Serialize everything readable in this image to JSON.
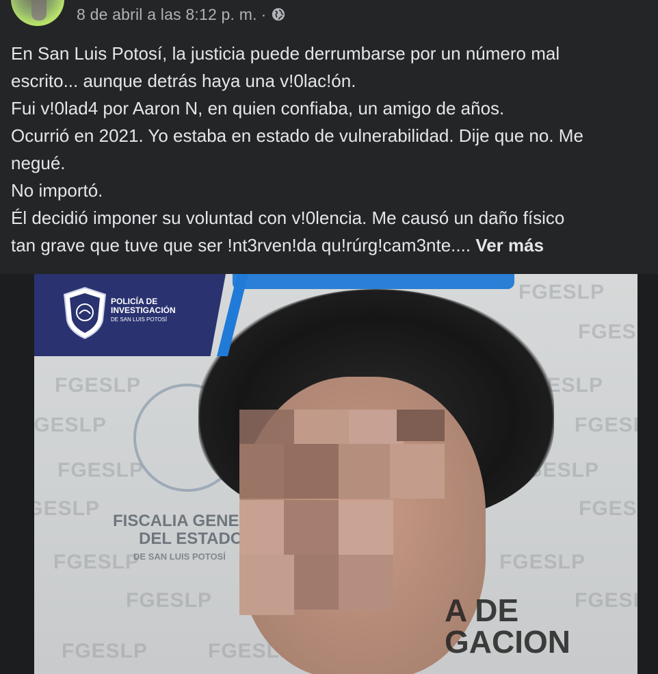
{
  "header": {
    "timestamp": "8 de abril a las 8:12 p. m.",
    "separator": "·",
    "privacy_icon": "globe-icon"
  },
  "post": {
    "lines": [
      "En San Luis Potosí, la justicia puede derrumbarse por un número mal",
      "escrito... aunque detrás haya una v!0lac!ón.",
      "Fui v!0lad4 por Aaron N, en quien confiaba, un amigo de años.",
      "Ocurrió en 2021. Yo estaba en estado de vulnerabilidad. Dije que no. Me",
      "negué.",
      "No importó.",
      "Él decidió imponer su voluntad con v!0lencia. Me causó un daño físico",
      "tan grave que tuve que ser !nt3rven!da qu!rúrg!cam3nte...."
    ],
    "see_more": "Ver más"
  },
  "photo": {
    "badge_line1": "Policía de",
    "badge_line2": "Investigación",
    "badge_line3": "de San Luis Potosí",
    "fiscalia_line1": "FISCALIA GENERAL",
    "fiscalia_line2": "DEL ESTADO",
    "fiscalia_line3": "DE SAN LUIS POTOSÍ",
    "watermark": "FGESLP",
    "shirt_line1": "A DE",
    "shirt_line2": "GACION",
    "colors": {
      "badge": "#2a3270",
      "accent": "#1f7ad8"
    }
  }
}
